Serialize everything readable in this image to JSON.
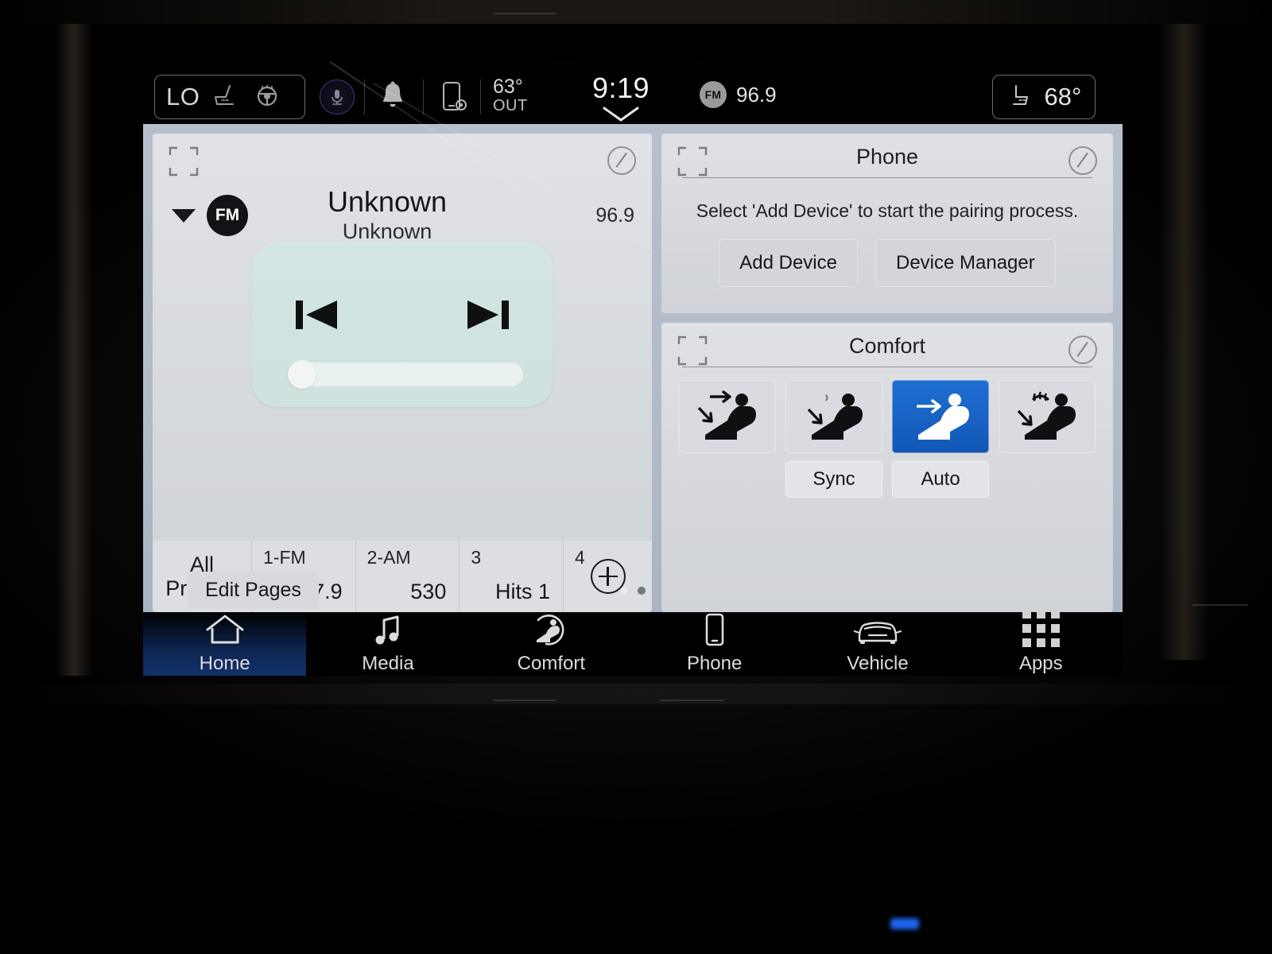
{
  "statusbar": {
    "climate_level": "LO",
    "seat_heat_icon": "seat-heat-icon",
    "wheel_heat_icon": "steering-wheel-heat-icon",
    "voice_icon": "voice-assistant-icon",
    "bell_icon": "notification-bell-icon",
    "device_icon": "device-settings-icon",
    "outside_temp": "63°",
    "outside_label": "OUT",
    "clock": "9:19",
    "clock_caret_icon": "chevron-down-icon",
    "radio_band": "FM",
    "radio_freq": "96.9",
    "passenger_seat_icon": "seat-icon",
    "passenger_temp": "68°"
  },
  "media": {
    "expand_icon": "expand-card-icon",
    "edit_icon": "edit-pencil-icon",
    "source_caret_icon": "chevron-down-icon",
    "source_band": "FM",
    "track_title": "Unknown",
    "track_artist": "Unknown",
    "frequency": "96.9",
    "prev_icon": "skip-previous-icon",
    "next_icon": "skip-next-icon",
    "presets": [
      {
        "num": "",
        "label": "All",
        "label2": "Presets",
        "val": ""
      },
      {
        "num": "1-FM",
        "val": "87.9"
      },
      {
        "num": "2-AM",
        "val": "530"
      },
      {
        "num": "3",
        "val": "Hits 1"
      },
      {
        "num": "4",
        "val": ""
      }
    ],
    "add_preset_icon": "add-preset-icon"
  },
  "phone": {
    "title": "Phone",
    "expand_icon": "expand-card-icon",
    "edit_icon": "edit-pencil-icon",
    "message": "Select 'Add Device' to start the pairing process.",
    "add_device": "Add Device",
    "device_manager": "Device Manager"
  },
  "comfort": {
    "title": "Comfort",
    "expand_icon": "expand-card-icon",
    "edit_icon": "edit-pencil-icon",
    "modes": [
      {
        "name": "airflow-face-and-feet",
        "active": false
      },
      {
        "name": "airflow-feet",
        "active": false
      },
      {
        "name": "airflow-face",
        "active": true
      },
      {
        "name": "airflow-defrost-and-feet",
        "active": false
      }
    ],
    "sync_label": "Sync",
    "auto_label": "Auto"
  },
  "home_foot": {
    "edit_pages": "Edit Pages",
    "page_count": 2,
    "active_page": 1
  },
  "nav": {
    "items": [
      {
        "label": "Home",
        "icon": "home-icon",
        "active": true
      },
      {
        "label": "Media",
        "icon": "music-note-icon",
        "active": false
      },
      {
        "label": "Comfort",
        "icon": "comfort-seat-icon",
        "active": false
      },
      {
        "label": "Phone",
        "icon": "phone-icon",
        "active": false
      },
      {
        "label": "Vehicle",
        "icon": "car-icon",
        "active": false
      },
      {
        "label": "Apps",
        "icon": "apps-grid-icon",
        "active": false
      }
    ]
  },
  "colors": {
    "accent_blue": "#1565c8",
    "panel_bg": "#dcdee2",
    "page_bg": "#b2bcc9",
    "art_teal": "#cfe3e1",
    "status_text": "#d6d6d6"
  }
}
